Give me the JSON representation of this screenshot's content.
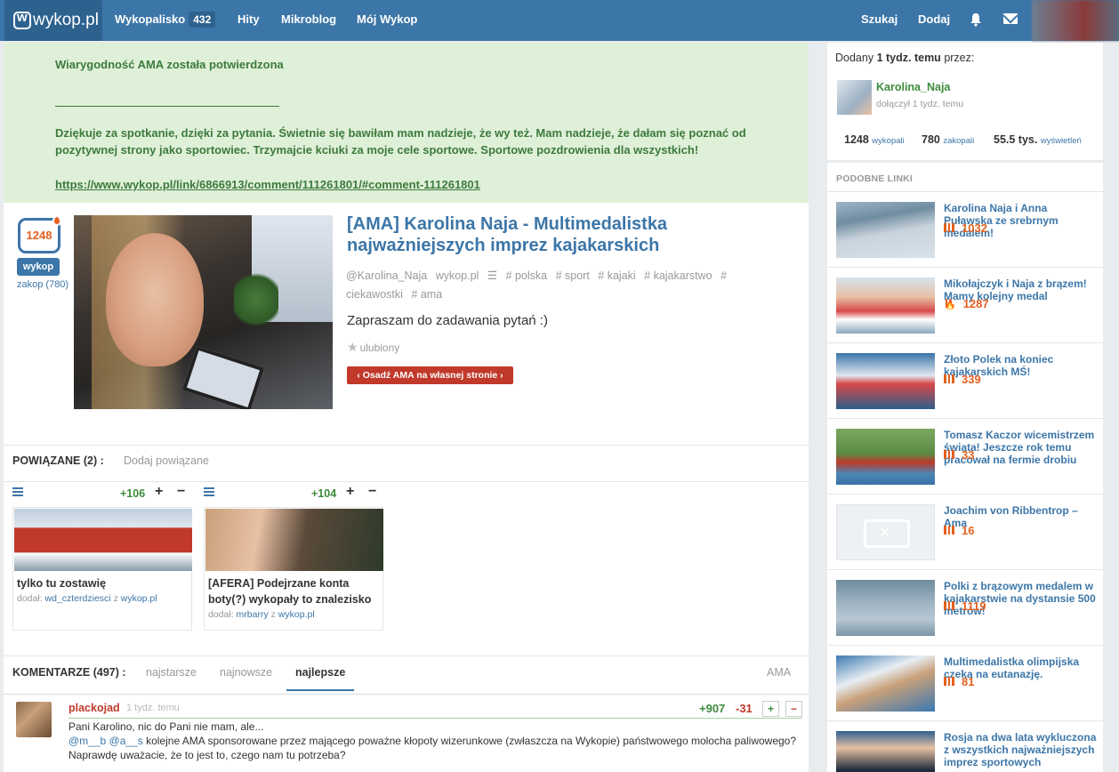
{
  "nav": {
    "logo": "wykop.pl",
    "items": [
      {
        "label": "Wykopalisko",
        "badge": "432"
      },
      {
        "label": "Hity"
      },
      {
        "label": "Mikroblog"
      },
      {
        "label": "Mój Wykop"
      }
    ],
    "search": "Szukaj",
    "add": "Dodaj",
    "icons": [
      "bell-icon",
      "mail-icon"
    ]
  },
  "ama_box": {
    "line1": "Wiarygodność AMA została potwierdzona",
    "line2": "Dziękuje za spotkanie, dzięki za pytania. Świetnie się bawiłam mam nadzieje, że wy też. Mam nadzieje, że dałam się poznać od pozytywnej strony jako sportowiec. Trzymajcie kciuki za moje cele sportowe. Sportowe pozdrowienia dla wszystkich!",
    "link": "https://www.wykop.pl/link/6866913/comment/111261801/#comment-111261801"
  },
  "post": {
    "votes": "1248",
    "wykop_label": "wykop",
    "zakop_label": "zakop (780)",
    "title": "[AMA] Karolina Naja - Multimedalistka najważniejszych imprez kajakarskich",
    "author": "@Karolina_Naja",
    "source": "wykop.pl",
    "tags": [
      "# polska",
      "# sport",
      "# kajaki",
      "# kajakarstwo",
      "# ciekawostki",
      "# ama"
    ],
    "description": "Zapraszam do zadawania pytań :)",
    "favorite": "ulubiony",
    "embed_button": "‹ Osadź AMA na własnej stronie ›"
  },
  "related": {
    "header": "POWIĄZANE (2) :",
    "add": "Dodaj powiązane",
    "items": [
      {
        "score": "+106",
        "title": "tylko tu zostawię",
        "by_prefix": "dodał:",
        "user": "wd_czterdziesci",
        "mid": "z",
        "source": "wykop.pl"
      },
      {
        "score": "+104",
        "title": "[AFERA] Podejrzane konta boty(?) wykopały to znalezisko",
        "by_prefix": "dodał:",
        "user": "mrbarry",
        "mid": "z",
        "source": "wykop.pl"
      }
    ],
    "plus": "+",
    "minus": "−"
  },
  "comments": {
    "header": "KOMENTARZE (497) :",
    "tabs": [
      "najstarsze",
      "najnowsze",
      "najlepsze"
    ],
    "ama_tab": "AMA",
    "first": {
      "user": "plackojad",
      "time": "1 tydz. temu",
      "plus_score": "+907",
      "minus_score": "-31",
      "line1": "Pani Karolino, nic do Pani nie mam, ale...",
      "mention1": "@m__b",
      "mention2": "@a__s",
      "line2": " kolejne AMA sponsorowane przez mającego poważne kłopoty wizerunkowe (zwłaszcza na Wykopie) państwowego molocha paliwowego? Naprawdę uważacie, że to jest to, czego nam tu potrzeba?"
    }
  },
  "sidebar": {
    "added_prefix": "Dodany",
    "added_time": "1 tydz. temu",
    "added_suffix": "przez:",
    "user": "Karolina_Naja",
    "joined": "dołączył 1 tydz. temu",
    "stats": [
      {
        "value": "1248",
        "label": "wykopali"
      },
      {
        "value": "780",
        "label": "zakopali"
      },
      {
        "value": "55.5 tys.",
        "label": "wyświetleń"
      }
    ],
    "similar_header": "PODOBNE LINKI",
    "similar": [
      {
        "title": "Karolina Naja i Anna Puławska ze srebrnym medalem!",
        "score": "1032",
        "img": "img-flags",
        "hot": false
      },
      {
        "title": "Mikołajczyk i Naja z brązem! Mamy kolejny medal",
        "score": "1287",
        "img": "img-kayak",
        "hot": true
      },
      {
        "title": "Złoto Polek na koniec kajakarskich MŚ!",
        "score": "339",
        "img": "img-polek",
        "hot": false
      },
      {
        "title": "Tomasz Kaczor wicemistrzem świata! Jeszcze rok temu pracował na fermie drobiu",
        "score": "33",
        "img": "img-kaczor",
        "hot": false
      },
      {
        "title": "Joachim von Ribbentrop – Ama",
        "score": "16",
        "img": "img-empty",
        "hot": false
      },
      {
        "title": "Polki z brązowym medalem w kajakarstwie na dystansie 500 metrów!",
        "score": "1119",
        "img": "img-boats",
        "hot": false
      },
      {
        "title": "Multimedalistka olimpijska czeka na eutanazję.",
        "score": "81",
        "img": "img-medal",
        "hot": false
      },
      {
        "title": "Rosja na dwa lata wykluczona z wszystkich najważniejszych imprez sportowych",
        "score": "",
        "img": "img-putin",
        "hot": false
      }
    ]
  }
}
